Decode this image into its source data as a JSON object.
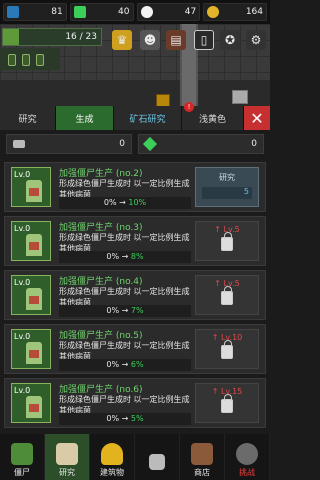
{
  "resources": [
    {
      "icon": "skull-icon",
      "value": "81",
      "color": "#2a7ab8"
    },
    {
      "icon": "flask-icon",
      "value": "40",
      "color": "#3bcf5a"
    },
    {
      "icon": "skull-white-icon",
      "value": "47",
      "color": "#f2f2f2"
    },
    {
      "icon": "coin-icon",
      "value": "164",
      "color": "#e2b52a"
    }
  ],
  "level": {
    "progress": "16 / 23"
  },
  "tabs": [
    {
      "label": "研究"
    },
    {
      "label": "生成"
    },
    {
      "label": "矿石研究"
    },
    {
      "label": "浅黄色",
      "badge": "!"
    }
  ],
  "currency": {
    "left": "0",
    "right": "0"
  },
  "research": [
    {
      "lv": "Lv.0",
      "title": "加强僵尸生产 (no.2)",
      "desc": "形成绿色僵尸生成时 以一定比例生成其他病菌",
      "from": "0%",
      "to": "10%",
      "action": "research",
      "action_label": "研究",
      "cost": "5"
    },
    {
      "lv": "Lv.0",
      "title": "加强僵尸生产 (no.3)",
      "desc": "形成绿色僵尸生成时 以一定比例生成其他病菌",
      "from": "0%",
      "to": "8%",
      "action": "locked",
      "req": "Lv.5"
    },
    {
      "lv": "Lv.0",
      "title": "加强僵尸生产 (no.4)",
      "desc": "形成绿色僵尸生成时 以一定比例生成其他病菌",
      "from": "0%",
      "to": "7%",
      "action": "locked",
      "req": "Lv.5"
    },
    {
      "lv": "Lv.0",
      "title": "加强僵尸生产 (no.5)",
      "desc": "形成绿色僵尸生成时 以一定比例生成其他病菌",
      "from": "0%",
      "to": "6%",
      "action": "locked",
      "req": "Lv.10"
    },
    {
      "lv": "Lv.0",
      "title": "加强僵尸生产 (no.6)",
      "desc": "形成绿色僵尸生成时 以一定比例生成其他病菌",
      "from": "0%",
      "to": "5%",
      "action": "locked",
      "req": "Lv.15"
    }
  ],
  "nav": [
    {
      "label": "僵尸",
      "icon": "zombie-hand-icon"
    },
    {
      "label": "研究",
      "icon": "clipboard-icon",
      "active": true
    },
    {
      "label": "建筑物",
      "icon": "helmet-icon"
    },
    {
      "label": "",
      "icon": "lock-icon"
    },
    {
      "label": "商店",
      "icon": "shop-icon"
    },
    {
      "label": "挑战",
      "icon": "gasmask-icon",
      "red": true
    }
  ]
}
